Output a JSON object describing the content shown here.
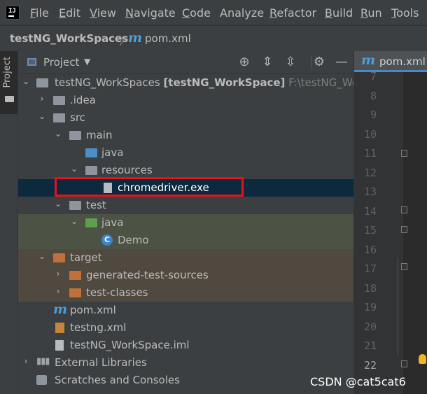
{
  "menu": {
    "items": [
      {
        "label": "File",
        "mnemonic": "F",
        "rest": "ile"
      },
      {
        "label": "Edit",
        "mnemonic": "E",
        "rest": "dit"
      },
      {
        "label": "View",
        "mnemonic": "V",
        "rest": "iew"
      },
      {
        "label": "Navigate",
        "mnemonic": "N",
        "rest": "avigate"
      },
      {
        "label": "Code",
        "mnemonic": "C",
        "rest": "ode"
      },
      {
        "label": "Analyze",
        "mnemonic": "",
        "rest": "Analyze"
      },
      {
        "label": "Refactor",
        "mnemonic": "R",
        "rest": "efactor"
      },
      {
        "label": "Build",
        "mnemonic": "B",
        "rest": "uild"
      },
      {
        "label": "Run",
        "mnemonic": "R",
        "rest": "un"
      },
      {
        "label": "Tools",
        "mnemonic": "T",
        "rest": "ools"
      }
    ]
  },
  "breadcrumb": {
    "project": "testNG_WorkSpaces",
    "file_icon": "m",
    "file": "pom.xml"
  },
  "toolstrip": {
    "label": "Project"
  },
  "panel": {
    "title": "Project",
    "header_icons": [
      "locate-icon",
      "expand-all-icon",
      "collapse-all-icon",
      "gear-icon",
      "hide-icon"
    ]
  },
  "tree": {
    "root": {
      "name": "testNG_WorkSpaces",
      "module": "[testNG_WorkSpace]",
      "path": "F:\\testNG_Work"
    },
    "idea": ".idea",
    "src": "src",
    "main": "main",
    "main_java": "java",
    "resources": "resources",
    "chromedriver": "chromedriver.exe",
    "test": "test",
    "test_java": "java",
    "demo": "Demo",
    "target": "target",
    "generated": "generated-test-sources",
    "test_classes": "test-classes",
    "pom": "pom.xml",
    "testng": "testng.xml",
    "iml": "testNG_WorkSpace.iml",
    "ext_libs": "External Libraries",
    "scratches": "Scratches and Consoles"
  },
  "editor": {
    "tab_icon": "m",
    "tab_label": "pom.xml",
    "line_numbers": [
      "7",
      "8",
      "9",
      "10",
      "11",
      "12",
      "13",
      "14",
      "15",
      "16",
      "17",
      "18",
      "19",
      "20",
      "21",
      "22"
    ],
    "current_line": "22"
  },
  "watermark": "CSDN @cat5cat6",
  "colors": {
    "accent": "#4a88c7",
    "selection": "#0d293e",
    "highlight_box": "#e8111a"
  }
}
